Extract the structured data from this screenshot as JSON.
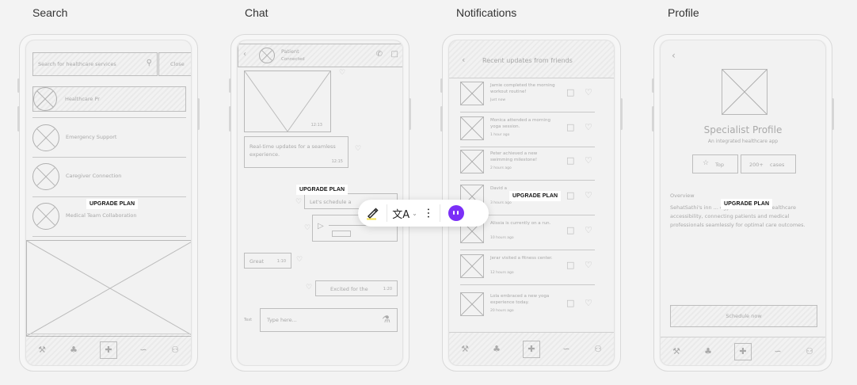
{
  "screens": {
    "search_title": "Search",
    "chat_title": "Chat",
    "notifications_title": "Notifications",
    "profile_title": "Profile"
  },
  "badge_label": "UPGRADE PLAN",
  "search": {
    "placeholder": "Search for healthcare services",
    "close_label": "Close",
    "items": [
      {
        "label": "Healthcare Pr"
      },
      {
        "label": "Emergency Support"
      },
      {
        "label": "Caregiver Connection"
      },
      {
        "label": "Medical Team Collaboration"
      }
    ]
  },
  "chat": {
    "contact_name": "Patient",
    "contact_status": "Connected",
    "image_time": "12:13",
    "msg1_text": "Real-time updates for a seamless experience.",
    "msg1_time": "12:15",
    "msg2_text": "Let's schedule a",
    "msg3_text": "Great",
    "msg3_time": "1:10",
    "msg4_text": "Excited for the",
    "msg4_time": "1:20",
    "composer_placeholder": "Type here...",
    "composer_prefix": "Text"
  },
  "notifications": {
    "header": "Recent updates from friends",
    "items": [
      {
        "text": "Jamie completed the morning workout routine!",
        "time": "Just now"
      },
      {
        "text": "Monica attended a morning yoga session.",
        "time": "1 hour ago"
      },
      {
        "text": "Peter achieved a new swimming milestone!",
        "time": "2 hours ago"
      },
      {
        "text": "David a",
        "time": "3 hours ago"
      },
      {
        "text": "Alissia is currently on a run.",
        "time": "10 hours ago"
      },
      {
        "text": "Jerar visited a fitness center.",
        "time": "12 hours ago"
      },
      {
        "text": "Lola embraced a new yoga experience today.",
        "time": "20 hours ago"
      }
    ]
  },
  "profile": {
    "title": "Specialist Profile",
    "subtitle": "An integrated healthcare app",
    "stat1_label": "Top",
    "stat2_value": "200+",
    "stat2_label": "cases",
    "overview_label": "Overview",
    "overview_text": "SehatSathi's inn ... ogy revolutionizes healthcare accessibility, connecting patients and medical professionals seamlessly for optimal care outcomes.",
    "cta_label": "Schedule now"
  },
  "colors": {
    "accent_purple": "#7b2ff7",
    "highlight_yellow": "#f4e04d"
  }
}
